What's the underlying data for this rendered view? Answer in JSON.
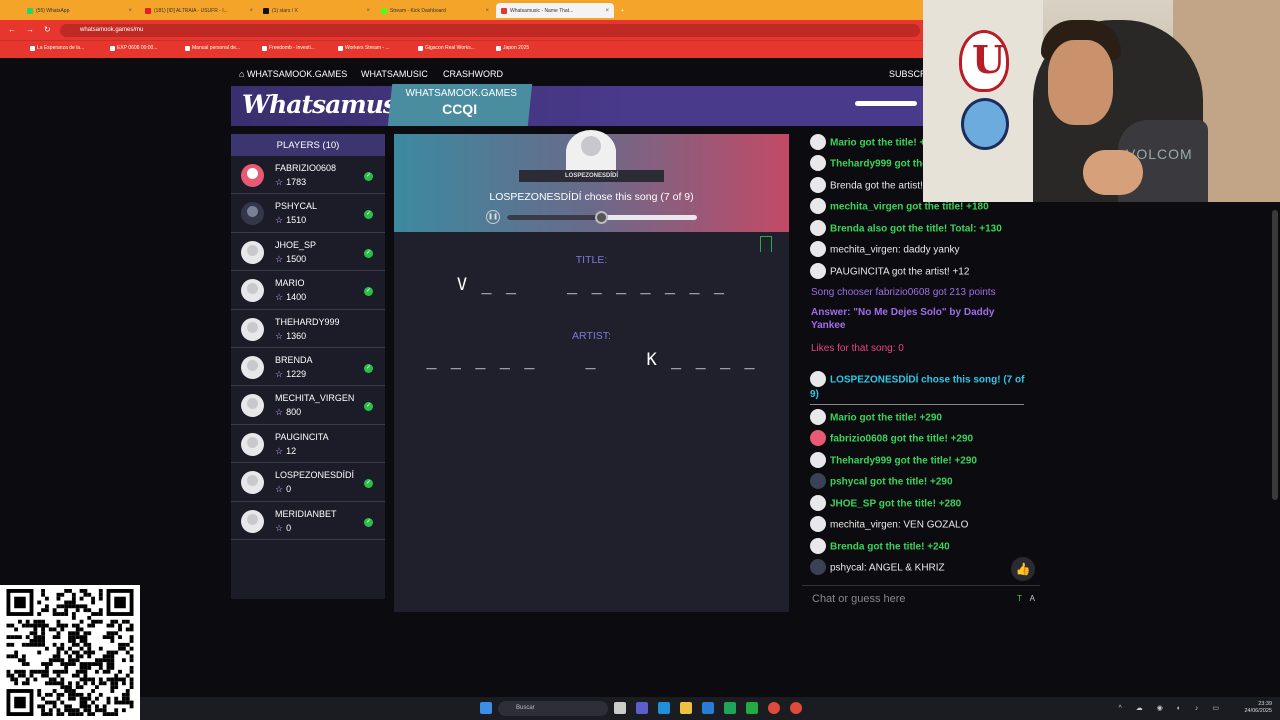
{
  "browser": {
    "tabs": [
      {
        "label": "(55) WhatsApp",
        "color": "#25d366"
      },
      {
        "label": "(181) [ID] ALTRAIA - USUFR - I...",
        "color": "#e81c28"
      },
      {
        "label": "(1) stars / X",
        "color": "#111111"
      },
      {
        "label": "Stream - Kick Dashboard",
        "color": "#53fc18"
      },
      {
        "label": "Whatsamusic - Name That...",
        "color": "#e7362e"
      }
    ],
    "url": "whatsamook.games/mu",
    "bookmarks": [
      "La Esperanza de la...",
      "EXP 0608 00:00...",
      "Manual personal de...",
      "Freedomb - Investi...",
      "Workers Stream - ...",
      "Gigacon Real Works...",
      "Japon 2025"
    ]
  },
  "site_nav": {
    "home": "WHATSAMOOK.GAMES",
    "music": "WHATSAMUSIC",
    "crash": "CRASHWORD",
    "subscribe": "SUBSCR"
  },
  "header": {
    "logo": "Whatsamusic",
    "room_site": "WHATSAMOOK.GAMES",
    "room_code": "CCQI"
  },
  "players": {
    "title": "PLAYERS (10)",
    "list": [
      {
        "name": "FABRIZIO0608",
        "score": "1783",
        "avatar": "red",
        "done": true
      },
      {
        "name": "PSHYCAL",
        "score": "1510",
        "avatar": "dark",
        "done": true
      },
      {
        "name": "JHOE_SP",
        "score": "1500",
        "avatar": "plain",
        "done": true
      },
      {
        "name": "MARIO",
        "score": "1400",
        "avatar": "plain",
        "done": true
      },
      {
        "name": "THEHARDY999",
        "score": "1360",
        "avatar": "plain",
        "done": false
      },
      {
        "name": "BRENDA",
        "score": "1229",
        "avatar": "plain",
        "done": true
      },
      {
        "name": "MECHITA_VIRGEN",
        "score": "800",
        "avatar": "plain",
        "done": true
      },
      {
        "name": "PAUGINCITA",
        "score": "12",
        "avatar": "plain",
        "done": false
      },
      {
        "name": "LOSPEZONESDÍDÍ",
        "score": "0",
        "avatar": "plain",
        "done": true
      },
      {
        "name": "MERIDIANBET",
        "score": "0",
        "avatar": "plain",
        "done": true
      }
    ]
  },
  "game": {
    "chooser_tag": "LOSPEZONESDÍDÍ",
    "chose_text": "LOSPEZONESDÍDÍ chose this song (7 of 9)",
    "progress": 0.5,
    "title_label": "TITLE:",
    "title_hint": "V _ _    _ _ _ _ _ _ _",
    "artist_label": "ARTIST:",
    "artist_hint": "_ _ _ _ _    _    K _ _ _ _"
  },
  "chat": {
    "messages": [
      {
        "t": "Mario got the title! +290",
        "c": "green",
        "av": "plain"
      },
      {
        "t": "Thehardy999 got the title! +290",
        "c": "green",
        "av": "plain"
      },
      {
        "t": "Brenda got the artist! +",
        "c": "white",
        "av": "plain"
      },
      {
        "t": "mechita_virgen got the title! +180",
        "c": "green",
        "av": "plain"
      },
      {
        "t": "Brenda also got the title! Total: +130",
        "c": "green",
        "av": "plain"
      },
      {
        "t": "mechita_virgen: daddy yanky",
        "c": "white",
        "av": "plain"
      },
      {
        "t": "PAUGINCITA got the artist! +12",
        "c": "white",
        "av": "plain"
      },
      {
        "t": "Song chooser fabrizio0608 got 213 points",
        "c": "purple",
        "av": ""
      },
      {
        "t": "Answer: \"No Me Dejes Solo\" by Daddy Yankee",
        "c": "purpleb",
        "av": ""
      },
      {
        "t": "Likes for that song: 0",
        "c": "pink",
        "av": ""
      },
      {
        "t": "LOSPEZONESDÍDÍ chose this song! (7 of 9)",
        "c": "cyan",
        "av": "plain"
      },
      {
        "t": "Mario got the title! +290",
        "c": "green",
        "av": "plain"
      },
      {
        "t": "fabrizio0608 got the title! +290",
        "c": "green",
        "av": "red"
      },
      {
        "t": "Thehardy999 got the title! +290",
        "c": "green",
        "av": "plain"
      },
      {
        "t": "pshycal got the title! +290",
        "c": "green",
        "av": "dark"
      },
      {
        "t": "JHOE_SP got the title! +280",
        "c": "green",
        "av": "plain"
      },
      {
        "t": "mechita_virgen: VEN GOZALO",
        "c": "white",
        "av": "plain"
      },
      {
        "t": "Brenda got the title! +240",
        "c": "green",
        "av": "plain"
      },
      {
        "t": "pshycal: ANGEL & KHRIZ",
        "c": "white",
        "av": "dark"
      }
    ],
    "input_placeholder": "Chat or guess here",
    "text_btn": "T",
    "a_btn": "A"
  },
  "webcam": {
    "shirt_text": "VOLCOM"
  },
  "taskbar": {
    "search": "Buscar",
    "time": "23:39",
    "date": "24/06/2025"
  }
}
